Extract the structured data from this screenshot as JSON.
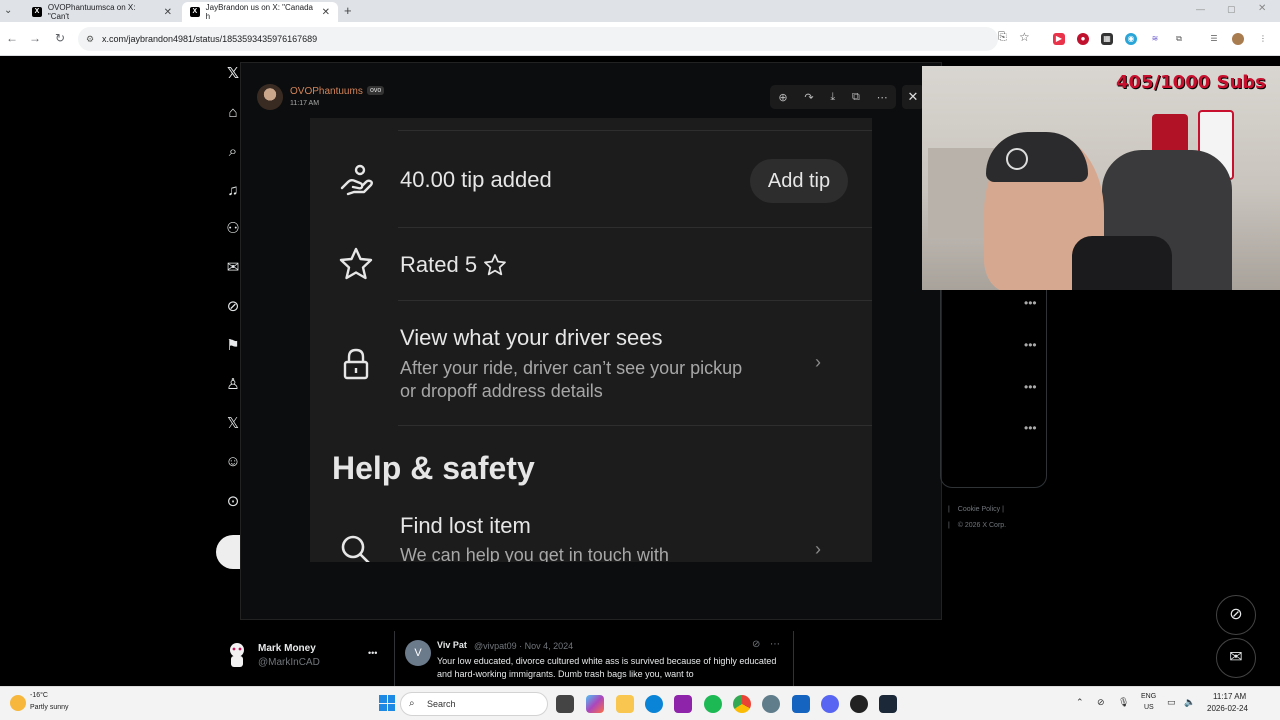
{
  "browser": {
    "tabs": [
      {
        "title": "OVOPhantuumsca on X: \"Can't",
        "active": false
      },
      {
        "title": "JayBrandon us on X: \"Canada h",
        "active": true
      }
    ],
    "new_tab": "+",
    "url": "x.com/jaybrandon4981/status/1853593435976167689"
  },
  "post": {
    "author": "OVOPhantuums",
    "badge": "ovo",
    "time": "11:17 AM"
  },
  "uber_screen": {
    "tip_text": "40.00 tip added",
    "add_tip_label": "Add tip",
    "rating_text": "Rated 5",
    "driver_title": "View what your driver sees",
    "driver_desc_1": "After your ride, driver can’t see your pickup",
    "driver_desc_2": "or dropoff address details",
    "section_title": "Help & safety",
    "lost_title": "Find lost item",
    "lost_desc": "We can help you get in touch with"
  },
  "footer": {
    "cookie": "Cookie Policy",
    "copyright": "© 2026 X Corp."
  },
  "stream": {
    "subs": "405/1000 Subs"
  },
  "account": {
    "name": "Mark Money",
    "handle": "@MarkInCAD",
    "more": "•••"
  },
  "tweet": {
    "avatar_letter": "V",
    "author": "Viv Pat",
    "meta": "@vivpat09 · Nov 4, 2024",
    "text": "Your low educated, divorce cultured white ass is survived because of highly educated and hard-working immigrants. Dumb trash bags like you, want to"
  },
  "taskbar": {
    "temp": "-16°C",
    "condition": "Partly sunny",
    "search": "Search",
    "lang1": "ENG",
    "lang2": "US",
    "time": "11:17 AM",
    "date": "2026-02-24"
  }
}
